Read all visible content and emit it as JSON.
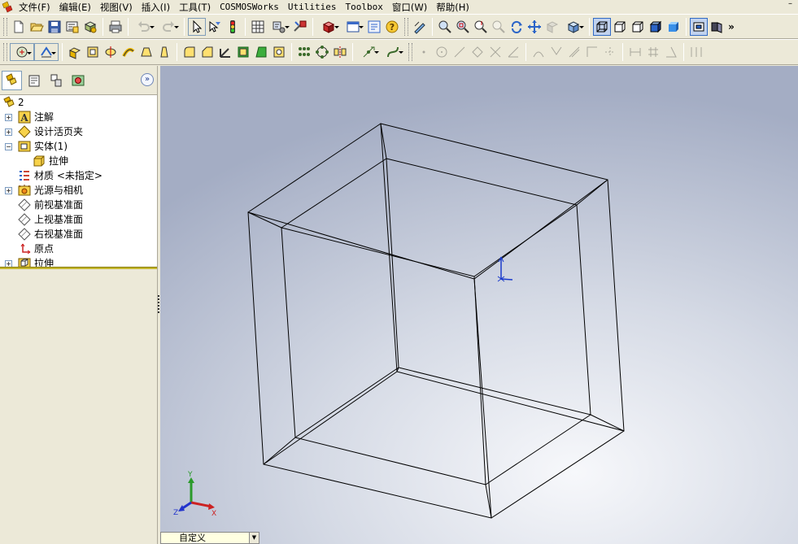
{
  "menubar": {
    "items": [
      {
        "label": "文件(F)",
        "mono": false
      },
      {
        "label": "编辑(E)",
        "mono": false
      },
      {
        "label": "视图(V)",
        "mono": false
      },
      {
        "label": "插入(I)",
        "mono": false
      },
      {
        "label": "工具(T)",
        "mono": false
      },
      {
        "label": "COSMOSWorks",
        "mono": true
      },
      {
        "label": "Utilities",
        "mono": true
      },
      {
        "label": "Toolbox",
        "mono": true
      },
      {
        "label": "窗口(W)",
        "mono": false
      },
      {
        "label": "帮助(H)",
        "mono": false
      }
    ],
    "window_button": "–"
  },
  "feature_tree": {
    "root": "2",
    "items": [
      {
        "label": "注解",
        "expander": "+",
        "icon": "annotation-icon"
      },
      {
        "label": "设计活页夹",
        "expander": "+",
        "icon": "design-binder-icon"
      },
      {
        "label": "实体(1)",
        "expander": "−",
        "icon": "solid-bodies-icon"
      },
      {
        "label": "拉伸",
        "expander": "",
        "icon": "body-icon"
      },
      {
        "label": "材质 <未指定>",
        "expander": "",
        "icon": "material-icon"
      },
      {
        "label": "光源与相机",
        "expander": "+",
        "icon": "lights-camera-icon"
      },
      {
        "label": "前视基准面",
        "expander": "",
        "icon": "plane-icon"
      },
      {
        "label": "上视基准面",
        "expander": "",
        "icon": "plane-icon"
      },
      {
        "label": "右视基准面",
        "expander": "",
        "icon": "plane-icon"
      },
      {
        "label": "原点",
        "expander": "",
        "icon": "origin-icon"
      },
      {
        "label": "拉伸",
        "expander": "+",
        "icon": "extrude-feature-icon"
      }
    ]
  },
  "viewport": {
    "triad_labels": {
      "x": "X",
      "y": "Y",
      "z": "Z"
    }
  },
  "status": {
    "configuration": "自定义"
  }
}
